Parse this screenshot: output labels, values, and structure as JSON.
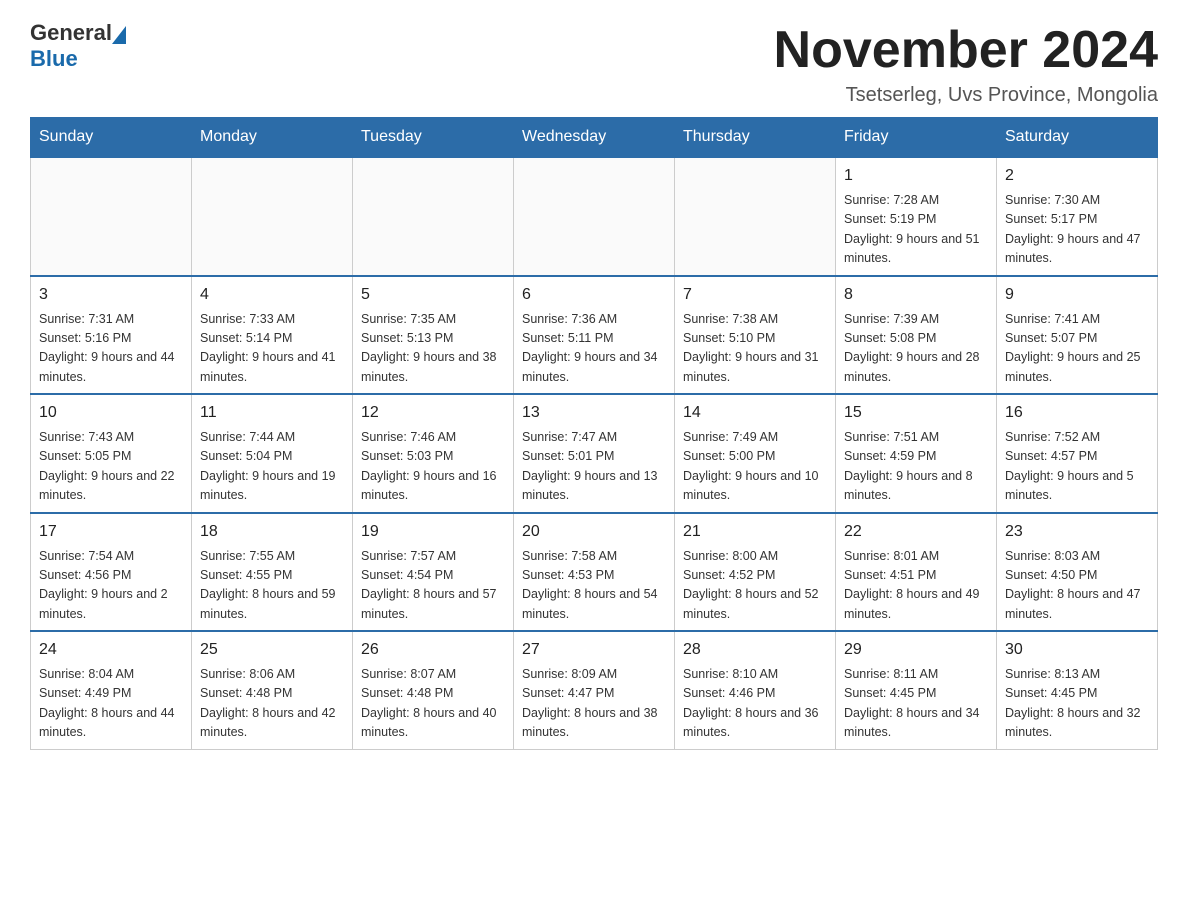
{
  "header": {
    "logo": {
      "text_general": "General",
      "text_blue": "Blue"
    },
    "title": "November 2024",
    "subtitle": "Tsetserleg, Uvs Province, Mongolia"
  },
  "calendar": {
    "days_of_week": [
      "Sunday",
      "Monday",
      "Tuesday",
      "Wednesday",
      "Thursday",
      "Friday",
      "Saturday"
    ],
    "weeks": [
      [
        {
          "day": "",
          "info": ""
        },
        {
          "day": "",
          "info": ""
        },
        {
          "day": "",
          "info": ""
        },
        {
          "day": "",
          "info": ""
        },
        {
          "day": "",
          "info": ""
        },
        {
          "day": "1",
          "info": "Sunrise: 7:28 AM\nSunset: 5:19 PM\nDaylight: 9 hours and 51 minutes."
        },
        {
          "day": "2",
          "info": "Sunrise: 7:30 AM\nSunset: 5:17 PM\nDaylight: 9 hours and 47 minutes."
        }
      ],
      [
        {
          "day": "3",
          "info": "Sunrise: 7:31 AM\nSunset: 5:16 PM\nDaylight: 9 hours and 44 minutes."
        },
        {
          "day": "4",
          "info": "Sunrise: 7:33 AM\nSunset: 5:14 PM\nDaylight: 9 hours and 41 minutes."
        },
        {
          "day": "5",
          "info": "Sunrise: 7:35 AM\nSunset: 5:13 PM\nDaylight: 9 hours and 38 minutes."
        },
        {
          "day": "6",
          "info": "Sunrise: 7:36 AM\nSunset: 5:11 PM\nDaylight: 9 hours and 34 minutes."
        },
        {
          "day": "7",
          "info": "Sunrise: 7:38 AM\nSunset: 5:10 PM\nDaylight: 9 hours and 31 minutes."
        },
        {
          "day": "8",
          "info": "Sunrise: 7:39 AM\nSunset: 5:08 PM\nDaylight: 9 hours and 28 minutes."
        },
        {
          "day": "9",
          "info": "Sunrise: 7:41 AM\nSunset: 5:07 PM\nDaylight: 9 hours and 25 minutes."
        }
      ],
      [
        {
          "day": "10",
          "info": "Sunrise: 7:43 AM\nSunset: 5:05 PM\nDaylight: 9 hours and 22 minutes."
        },
        {
          "day": "11",
          "info": "Sunrise: 7:44 AM\nSunset: 5:04 PM\nDaylight: 9 hours and 19 minutes."
        },
        {
          "day": "12",
          "info": "Sunrise: 7:46 AM\nSunset: 5:03 PM\nDaylight: 9 hours and 16 minutes."
        },
        {
          "day": "13",
          "info": "Sunrise: 7:47 AM\nSunset: 5:01 PM\nDaylight: 9 hours and 13 minutes."
        },
        {
          "day": "14",
          "info": "Sunrise: 7:49 AM\nSunset: 5:00 PM\nDaylight: 9 hours and 10 minutes."
        },
        {
          "day": "15",
          "info": "Sunrise: 7:51 AM\nSunset: 4:59 PM\nDaylight: 9 hours and 8 minutes."
        },
        {
          "day": "16",
          "info": "Sunrise: 7:52 AM\nSunset: 4:57 PM\nDaylight: 9 hours and 5 minutes."
        }
      ],
      [
        {
          "day": "17",
          "info": "Sunrise: 7:54 AM\nSunset: 4:56 PM\nDaylight: 9 hours and 2 minutes."
        },
        {
          "day": "18",
          "info": "Sunrise: 7:55 AM\nSunset: 4:55 PM\nDaylight: 8 hours and 59 minutes."
        },
        {
          "day": "19",
          "info": "Sunrise: 7:57 AM\nSunset: 4:54 PM\nDaylight: 8 hours and 57 minutes."
        },
        {
          "day": "20",
          "info": "Sunrise: 7:58 AM\nSunset: 4:53 PM\nDaylight: 8 hours and 54 minutes."
        },
        {
          "day": "21",
          "info": "Sunrise: 8:00 AM\nSunset: 4:52 PM\nDaylight: 8 hours and 52 minutes."
        },
        {
          "day": "22",
          "info": "Sunrise: 8:01 AM\nSunset: 4:51 PM\nDaylight: 8 hours and 49 minutes."
        },
        {
          "day": "23",
          "info": "Sunrise: 8:03 AM\nSunset: 4:50 PM\nDaylight: 8 hours and 47 minutes."
        }
      ],
      [
        {
          "day": "24",
          "info": "Sunrise: 8:04 AM\nSunset: 4:49 PM\nDaylight: 8 hours and 44 minutes."
        },
        {
          "day": "25",
          "info": "Sunrise: 8:06 AM\nSunset: 4:48 PM\nDaylight: 8 hours and 42 minutes."
        },
        {
          "day": "26",
          "info": "Sunrise: 8:07 AM\nSunset: 4:48 PM\nDaylight: 8 hours and 40 minutes."
        },
        {
          "day": "27",
          "info": "Sunrise: 8:09 AM\nSunset: 4:47 PM\nDaylight: 8 hours and 38 minutes."
        },
        {
          "day": "28",
          "info": "Sunrise: 8:10 AM\nSunset: 4:46 PM\nDaylight: 8 hours and 36 minutes."
        },
        {
          "day": "29",
          "info": "Sunrise: 8:11 AM\nSunset: 4:45 PM\nDaylight: 8 hours and 34 minutes."
        },
        {
          "day": "30",
          "info": "Sunrise: 8:13 AM\nSunset: 4:45 PM\nDaylight: 8 hours and 32 minutes."
        }
      ]
    ]
  }
}
